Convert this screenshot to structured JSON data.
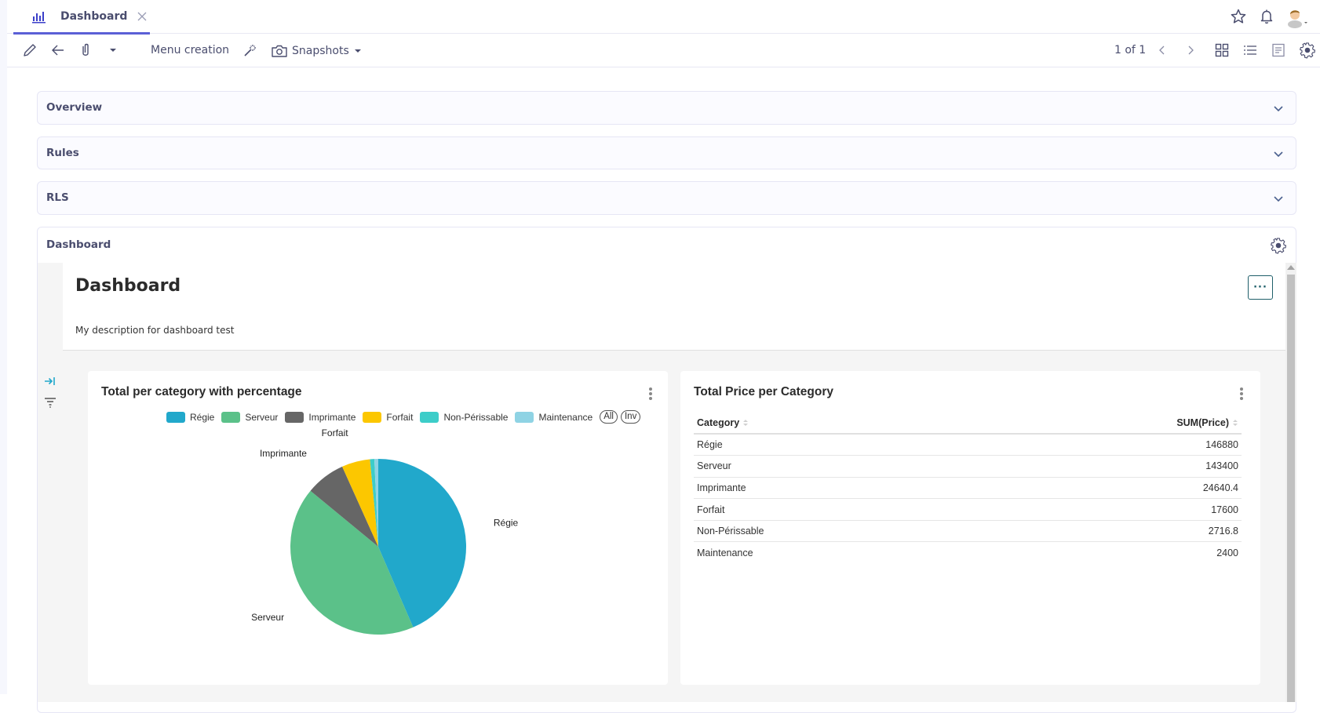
{
  "tabbar": {
    "active_tab": {
      "label": "Dashboard",
      "icon": "bar-chart-icon"
    },
    "right_icons": [
      "star-icon",
      "bell-icon",
      "user-avatar"
    ]
  },
  "toolbar": {
    "menu_creation_label": "Menu creation",
    "snapshots_label": "Snapshots",
    "pagination": "1 of 1",
    "icons": [
      "pencil-icon",
      "back-arrow-icon",
      "paperclip-icon",
      "caret-down-icon",
      "magic-wand-icon",
      "camera-icon",
      "chevron-left-icon",
      "chevron-right-icon",
      "grid-view-icon",
      "list-view-icon",
      "form-view-icon",
      "settings-gear-icon"
    ]
  },
  "panels": [
    {
      "title": "Overview",
      "expanded": false
    },
    {
      "title": "Rules",
      "expanded": false
    },
    {
      "title": "RLS",
      "expanded": false
    },
    {
      "title": "Dashboard",
      "expanded": true
    }
  ],
  "dashboard": {
    "title": "Dashboard",
    "description": "My description for dashboard test",
    "more_button_label": "···"
  },
  "pie_card": {
    "title": "Total per category with percentage",
    "legend_all": "All",
    "legend_inv": "Inv"
  },
  "table_card": {
    "title": "Total Price per Category",
    "columns": [
      "Category",
      "SUM(Price)"
    ],
    "rows": [
      [
        "Régie",
        "146880"
      ],
      [
        "Serveur",
        "143400"
      ],
      [
        "Imprimante",
        "24640.4"
      ],
      [
        "Forfait",
        "17600"
      ],
      [
        "Non-Périssable",
        "2716.8"
      ],
      [
        "Maintenance",
        "2400"
      ]
    ]
  },
  "chart_data": {
    "type": "pie",
    "title": "Total per category with percentage",
    "categories": [
      "Régie",
      "Serveur",
      "Imprimante",
      "Forfait",
      "Non-Périssable",
      "Maintenance"
    ],
    "values": [
      146880,
      143400,
      24640.4,
      17600,
      2716.8,
      2400
    ],
    "colors": [
      "#21a8cb",
      "#5bc189",
      "#666666",
      "#fcc700",
      "#3dcdc9",
      "#8fd3e4"
    ],
    "slice_labels": [
      "Régie",
      "Serveur",
      "Imprimante",
      "Forfait"
    ],
    "legend": "top"
  },
  "colors": {
    "accent": "#5b5fd6",
    "text": "#4a4d6e",
    "more_button": "#1f5f6a"
  }
}
